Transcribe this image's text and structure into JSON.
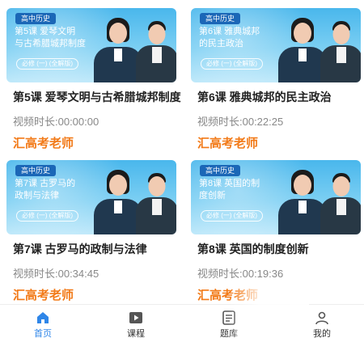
{
  "courses": [
    {
      "subject": "高中历史",
      "thumb_line1": "第5课 爱琴文明",
      "thumb_line2": "与古希腊城邦制度",
      "edition": "必修 (一) (全解版)",
      "title": "第5课 爱琴文明与古希腊城邦制度",
      "duration": "视频时长:00:00:00",
      "teacher": "汇高考老师"
    },
    {
      "subject": "高中历史",
      "thumb_line1": "第6课 雅典城邦",
      "thumb_line2": "的民主政治",
      "edition": "必修 (一) (全解版)",
      "title": "第6课 雅典城邦的民主政治",
      "duration": "视频时长:00:22:25",
      "teacher": "汇高考老师"
    },
    {
      "subject": "高中历史",
      "thumb_line1": "第7课 古罗马的",
      "thumb_line2": "政制与法律",
      "edition": "必修 (一) (全解版)",
      "title": "第7课 古罗马的政制与法律",
      "duration": "视频时长:00:34:45",
      "teacher": "汇高考老师"
    },
    {
      "subject": "高中历史",
      "thumb_line1": "第8课 英国的制",
      "thumb_line2": "度创新",
      "edition": "必修 (一) (全解版)",
      "title": "第8课 英国的制度创新",
      "duration": "视频时长:00:19:36",
      "teacher": "汇高考老师"
    }
  ],
  "tabs": [
    {
      "label": "首页",
      "icon": "home-icon",
      "active": true
    },
    {
      "label": "课程",
      "icon": "play-video-icon",
      "active": false
    },
    {
      "label": "题库",
      "icon": "question-bank-icon",
      "active": false
    },
    {
      "label": "我的",
      "icon": "profile-icon",
      "active": false
    }
  ],
  "colors": {
    "accent": "#2f86e8",
    "teacher": "#f27a18",
    "thumb": "#49b7ec"
  }
}
